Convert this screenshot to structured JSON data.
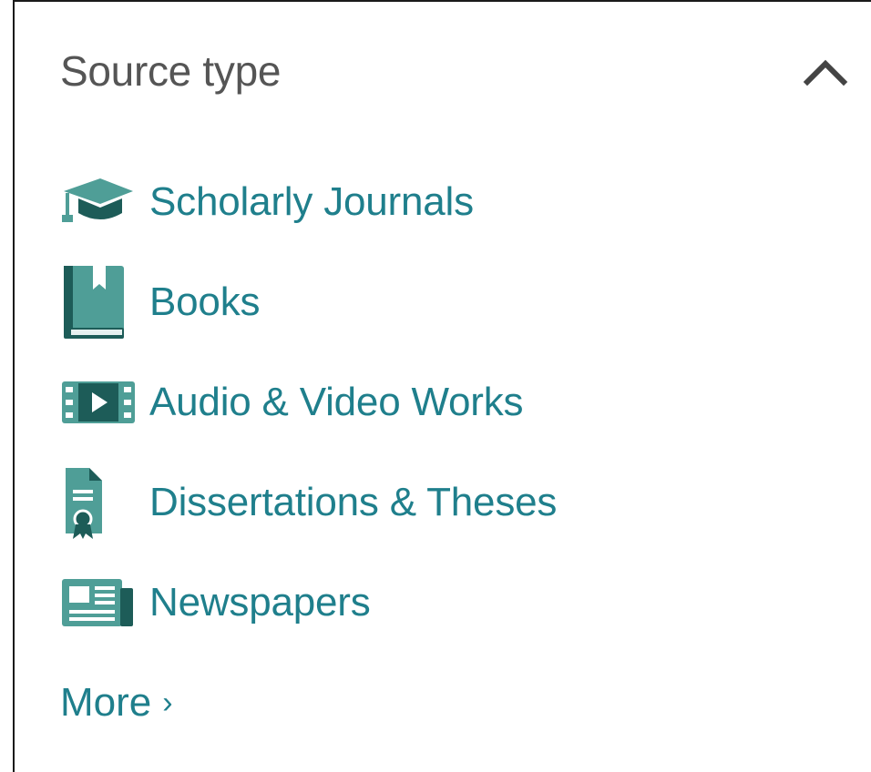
{
  "facet": {
    "title": "Source type",
    "toggle_icon": "chevron-up-icon",
    "items": [
      {
        "label": "Scholarly Journals",
        "icon": "graduation-cap-icon"
      },
      {
        "label": "Books",
        "icon": "book-icon"
      },
      {
        "label": "Audio & Video Works",
        "icon": "video-film-icon"
      },
      {
        "label": "Dissertations & Theses",
        "icon": "diploma-document-icon"
      },
      {
        "label": "Newspapers",
        "icon": "newspaper-icon"
      }
    ],
    "more_label": "More",
    "more_chevron": "›"
  },
  "colors": {
    "accent": "#1f7f8c",
    "icon_teal": "#4f9e97",
    "icon_dark": "#1d5c58",
    "title": "#555555",
    "toggle": "#444444",
    "border": "#1a1a1a"
  }
}
